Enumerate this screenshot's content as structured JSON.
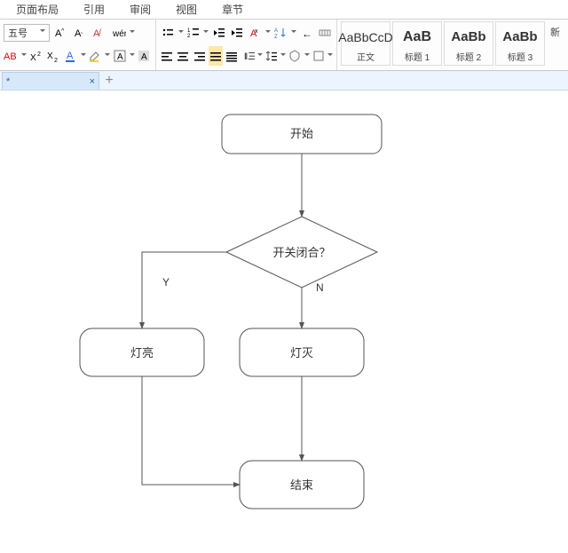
{
  "ribbon_tabs": {
    "page_layout": "页面布局",
    "references": "引用",
    "review": "审阅",
    "view": "视图",
    "chapters": "章节"
  },
  "font": {
    "size_label": "五号"
  },
  "styles": {
    "body": {
      "preview": "AaBbCcD",
      "label": "正文"
    },
    "h1": {
      "preview": "AaB",
      "label": "标题 1"
    },
    "h2": {
      "preview": "AaBb",
      "label": "标题 2"
    },
    "h3": {
      "preview": "AaBb",
      "label": "标题 3"
    },
    "new": "新"
  },
  "doc_tabs": {
    "doc1_mark": "*"
  },
  "chart_data": {
    "type": "flowchart",
    "nodes": [
      {
        "id": "start",
        "shape": "rounded-rect",
        "label": "开始"
      },
      {
        "id": "decision",
        "shape": "diamond",
        "label": "开关闭合？"
      },
      {
        "id": "on",
        "shape": "rounded-rect",
        "label": "灯亮"
      },
      {
        "id": "off",
        "shape": "rounded-rect",
        "label": "灯灭"
      },
      {
        "id": "end",
        "shape": "rounded-rect",
        "label": "结束"
      }
    ],
    "edges": [
      {
        "from": "start",
        "to": "decision",
        "label": ""
      },
      {
        "from": "decision",
        "to": "on",
        "label": "Y"
      },
      {
        "from": "decision",
        "to": "off",
        "label": "N"
      },
      {
        "from": "on",
        "to": "end",
        "label": ""
      },
      {
        "from": "off",
        "to": "end",
        "label": ""
      }
    ]
  }
}
